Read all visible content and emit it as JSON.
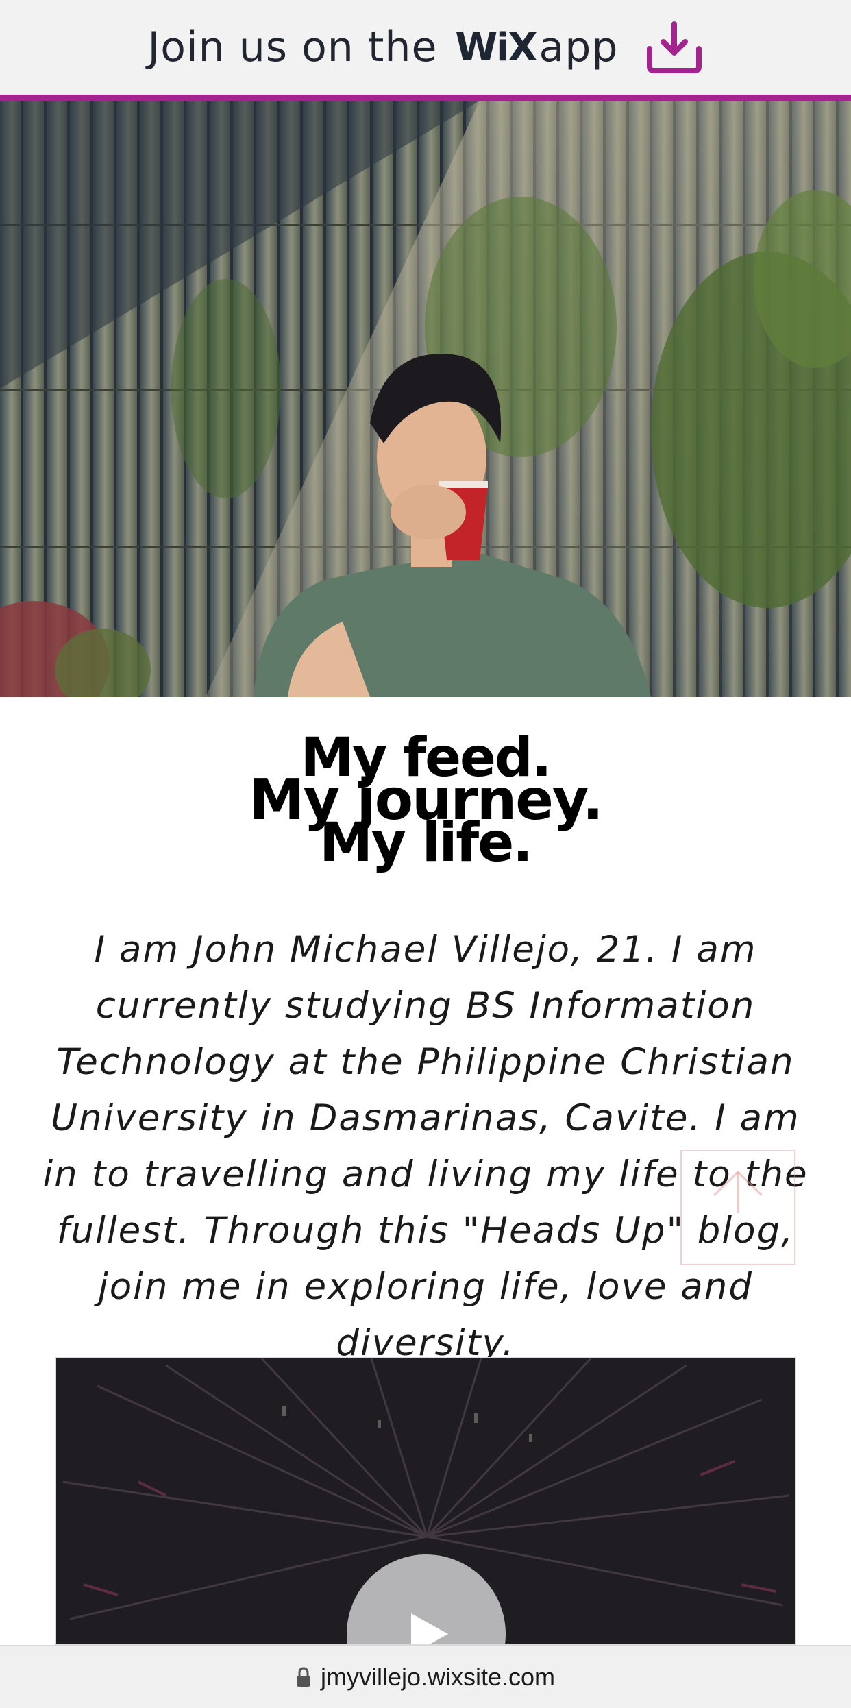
{
  "banner": {
    "prefix": "Join us on the",
    "brand": "WiX",
    "suffix": "app",
    "download_icon": "download-icon",
    "accent_color": "#a3248f"
  },
  "hero": {
    "image_icon": "hero-photo"
  },
  "headline": {
    "line1": "My feed.",
    "line2": "My journey.",
    "line3": "My life."
  },
  "bio": {
    "text": "I am John Michael Villejo, 21. I am currently studying BS Information Technology at the Philippine Christian University in Dasmarinas, Cavite. I am in to travelling and living my life to the fullest. Through this \"Heads Up\" blog, join me in exploring life, love and diversity."
  },
  "video": {
    "play_icon": "play-icon"
  },
  "back_to_top": {
    "icon": "arrow-up-icon"
  },
  "browser": {
    "url": "jmyvillejo.wixsite.com",
    "lock_icon": "lock-icon"
  }
}
